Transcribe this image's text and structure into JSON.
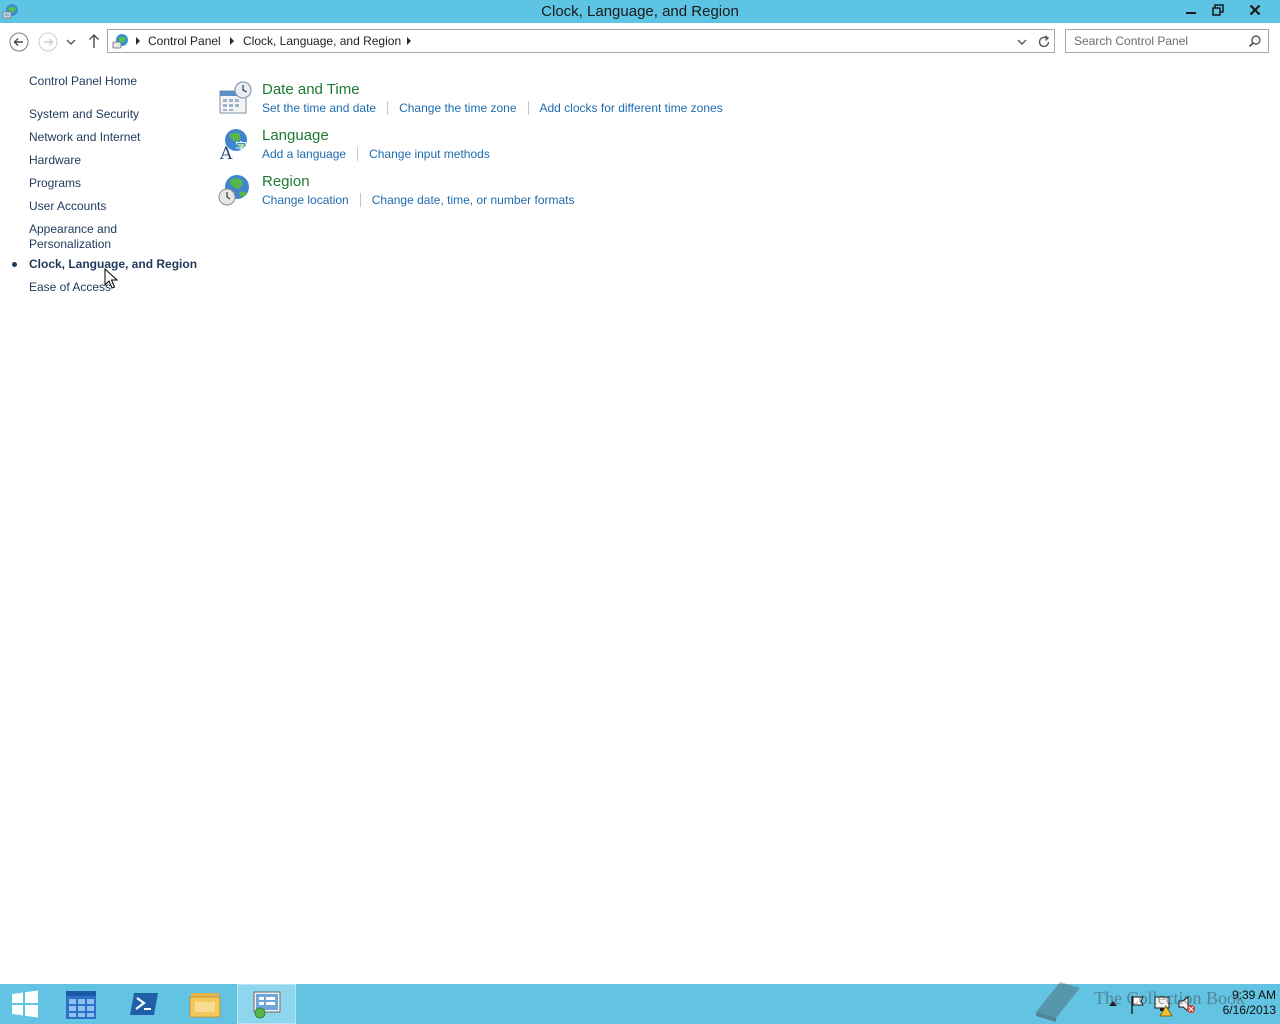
{
  "window": {
    "title": "Clock, Language, and Region",
    "titlebar_color": "#5ec4e3"
  },
  "nav": {
    "back_icon": "back-arrow-icon",
    "forward_icon": "forward-arrow-icon",
    "up_icon": "up-arrow-icon"
  },
  "address": {
    "crumbs": [
      "Control Panel",
      "Clock, Language, and Region"
    ]
  },
  "search": {
    "placeholder": "Search Control Panel"
  },
  "sidebar": {
    "home": "Control Panel Home",
    "items": [
      {
        "label": "System and Security"
      },
      {
        "label": "Network and Internet"
      },
      {
        "label": "Hardware"
      },
      {
        "label": "Programs"
      },
      {
        "label": "User Accounts"
      },
      {
        "label": "Appearance and",
        "label2": "Personalization"
      },
      {
        "label": "Clock, Language, and Region",
        "active": true
      },
      {
        "label": "Ease of Access"
      }
    ]
  },
  "categories": [
    {
      "title": "Date and Time",
      "icon": "calendar-clock-icon",
      "links": [
        "Set the time and date",
        "Change the time zone",
        "Add clocks for different time zones"
      ]
    },
    {
      "title": "Language",
      "icon": "language-globe-icon",
      "links": [
        "Add a language",
        "Change input methods"
      ]
    },
    {
      "title": "Region",
      "icon": "region-globe-icon",
      "links": [
        "Change location",
        "Change date, time, or number formats"
      ]
    }
  ],
  "taskbar": {
    "color": "#62c3e2",
    "time": "9:39 AM",
    "date": "6/16/2013"
  },
  "watermark": {
    "text": "The Collection Book"
  },
  "colors": {
    "link": "#1e6cb0",
    "category_title": "#1c7a32",
    "nav_text": "#1e395b"
  }
}
